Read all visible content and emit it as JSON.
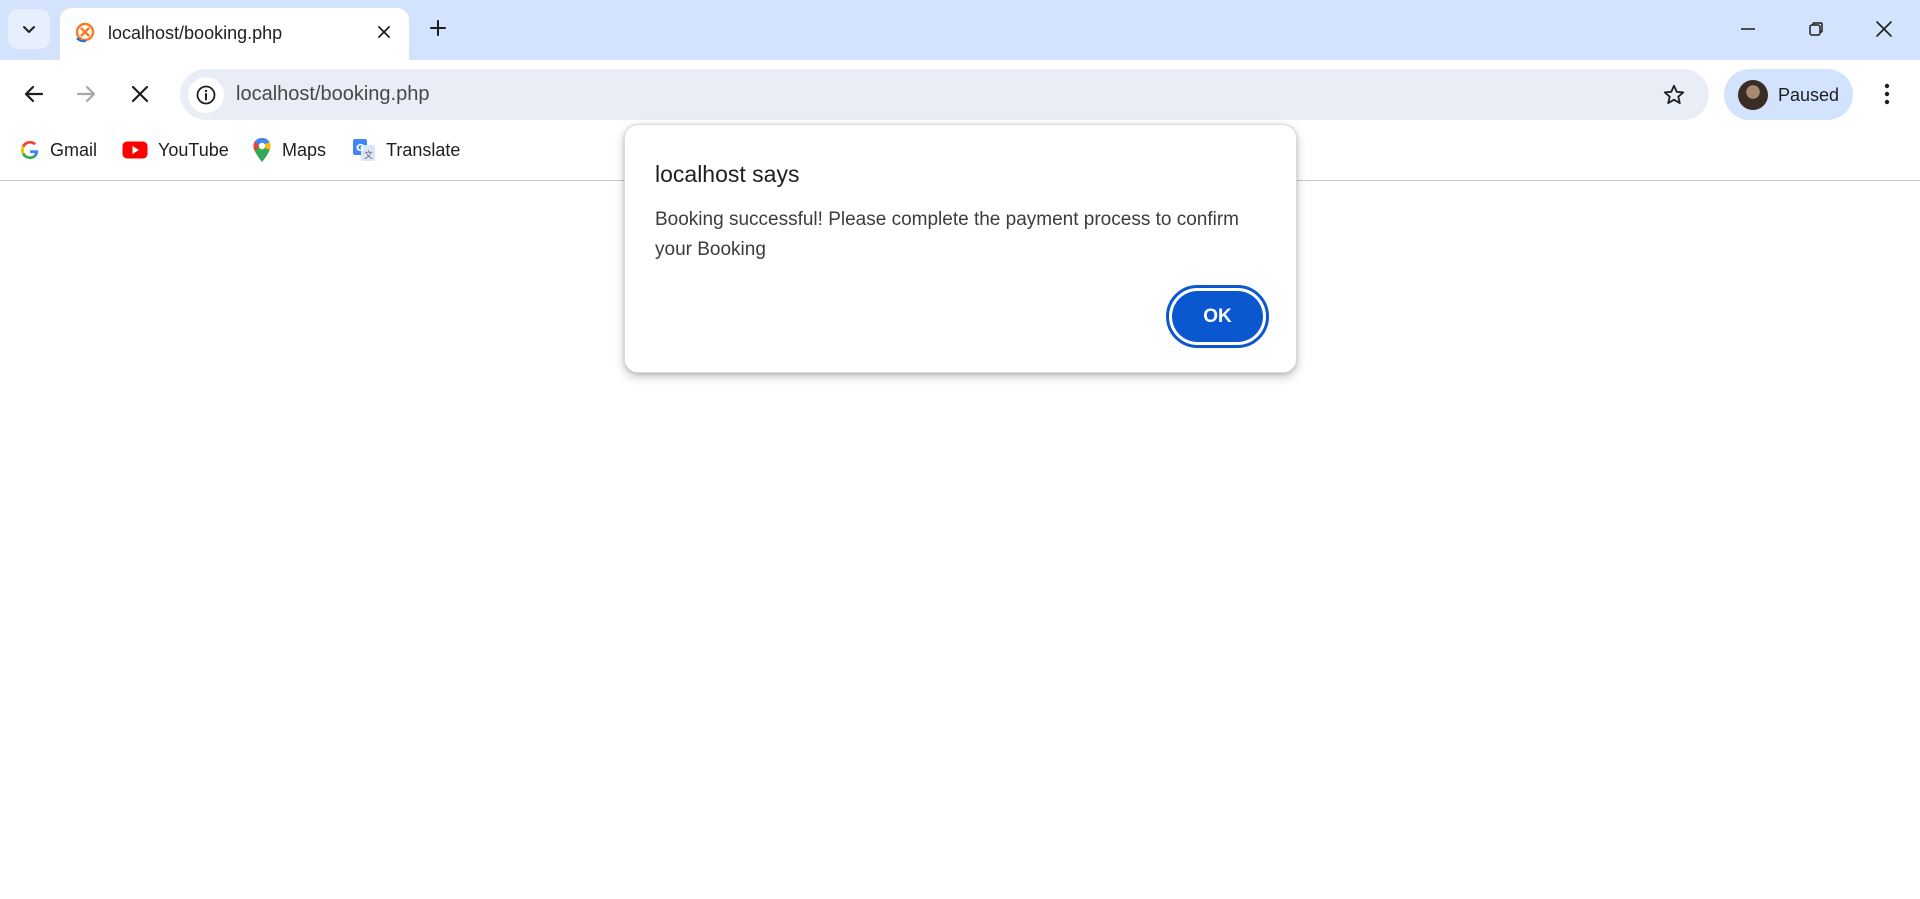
{
  "tab": {
    "title": "localhost/booking.php"
  },
  "omnibox": {
    "url": "localhost/booking.php"
  },
  "profile": {
    "label": "Paused"
  },
  "bookmarks": [
    {
      "label": "Gmail",
      "icon": "google-g-icon"
    },
    {
      "label": "YouTube",
      "icon": "youtube-icon"
    },
    {
      "label": "Maps",
      "icon": "maps-pin-icon"
    },
    {
      "label": "Translate",
      "icon": "translate-icon"
    }
  ],
  "dialog": {
    "title": "localhost says",
    "message": "Booking successful! Please complete the payment process to confirm your Booking",
    "ok_label": "OK"
  },
  "colors": {
    "tabstrip_bg": "#d3e3fd",
    "omnibox_bg": "#e9eef6",
    "accent": "#0b57d0"
  }
}
